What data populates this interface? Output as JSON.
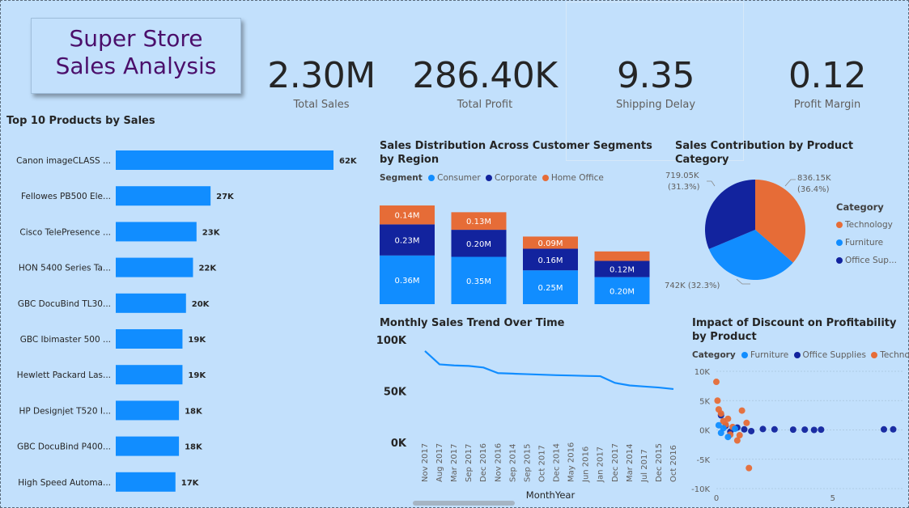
{
  "title": {
    "line1": "Super Store",
    "line2": "Sales Analysis"
  },
  "kpis": [
    {
      "value": "2.30M",
      "label": "Total Sales"
    },
    {
      "value": "286.40K",
      "label": "Total Profit"
    },
    {
      "value": "9.35",
      "label": "Shipping Delay"
    },
    {
      "value": "0.12",
      "label": "Profit Margin"
    }
  ],
  "colors": {
    "consumer": "#118dff",
    "corporate": "#12239e",
    "home_office": "#e66c37",
    "technology": "#e66c37",
    "furniture": "#118dff",
    "office_supplies": "#12239e",
    "background": "#c2e0fc"
  },
  "chart_data": [
    {
      "type": "bar",
      "title": "Top 10 Products by Sales",
      "orientation": "horizontal",
      "categories": [
        "Canon imageCLASS ...",
        "Fellowes PB500 Ele...",
        "Cisco TelePresence ...",
        "HON 5400 Series Ta...",
        "GBC DocuBind TL30...",
        "GBC Ibimaster 500 ...",
        "Hewlett Packard Las...",
        "HP Designjet T520 I...",
        "GBC DocuBind P400...",
        "High Speed Automa..."
      ],
      "values": [
        62,
        27,
        23,
        22,
        20,
        19,
        19,
        18,
        18,
        17
      ],
      "value_labels": [
        "62K",
        "27K",
        "23K",
        "22K",
        "20K",
        "19K",
        "19K",
        "18K",
        "18K",
        "17K"
      ],
      "color": "#118dff"
    },
    {
      "type": "bar",
      "stacked": true,
      "title": "Sales Distribution Across Customer Segments by Region",
      "legend_title": "Segment",
      "categories": [
        "",
        "",
        "",
        ""
      ],
      "series": [
        {
          "name": "Consumer",
          "color": "#118dff",
          "values": [
            0.36,
            0.35,
            0.25,
            0.2
          ],
          "labels": [
            "0.36M",
            "0.35M",
            "0.25M",
            "0.20M"
          ]
        },
        {
          "name": "Corporate",
          "color": "#12239e",
          "values": [
            0.23,
            0.2,
            0.16,
            0.12
          ],
          "labels": [
            "0.23M",
            "0.20M",
            "0.16M",
            "0.12M"
          ]
        },
        {
          "name": "Home Office",
          "color": "#e66c37",
          "values": [
            0.14,
            0.13,
            0.09,
            0.07
          ],
          "labels": [
            "0.14M",
            "0.13M",
            "0.09M",
            ""
          ]
        }
      ],
      "unit": "M"
    },
    {
      "type": "pie",
      "title": "Sales Contribution by Product Category",
      "legend_title": "Category",
      "slices": [
        {
          "name": "Technology",
          "value": 836.15,
          "percent": 36.4,
          "label": "836.15K",
          "pct_label": "(36.4%)",
          "color": "#e66c37"
        },
        {
          "name": "Furniture",
          "value": 742,
          "percent": 32.3,
          "label": "742K (32.3%)",
          "color": "#118dff"
        },
        {
          "name": "Office Sup...",
          "value": 719.05,
          "percent": 31.3,
          "label": "719.05K",
          "pct_label": "(31.3%)",
          "color": "#12239e"
        }
      ]
    },
    {
      "type": "line",
      "title": "Monthly Sales Trend Over Time",
      "xlabel": "MonthYear",
      "ylabel": "",
      "ylim": [
        0,
        100000
      ],
      "yticks": [
        "100K",
        "50K",
        "0K"
      ],
      "x": [
        "Nov 2017",
        "Aug 2017",
        "Mar 2017",
        "Sep 2017",
        "Dec 2016",
        "Nov 2016",
        "Sep 2014",
        "Sep 2015",
        "Oct 2017",
        "Dec 2014",
        "May 2016",
        "Jun 2016",
        "Jan 2017",
        "Dec 2017",
        "Mar 2014",
        "Jul 2017",
        "Dec 2015",
        "Oct 2016"
      ],
      "values": [
        89000,
        76000,
        75000,
        74500,
        73000,
        67500,
        67000,
        66500,
        66000,
        65500,
        65200,
        64800,
        64500,
        58000,
        55500,
        54500,
        53500,
        52000
      ],
      "color": "#118dff"
    },
    {
      "type": "scatter",
      "title": "Impact of Discount on Profitability by Product",
      "legend_title": "Category",
      "xlim": [
        0,
        8
      ],
      "ylim": [
        -10000,
        10000
      ],
      "xticks": [
        "0",
        "5"
      ],
      "yticks": [
        "10K",
        "5K",
        "0K",
        "-5K",
        "-10K"
      ],
      "series": [
        {
          "name": "Furniture",
          "color": "#118dff",
          "points": [
            [
              0.1,
              800
            ],
            [
              0.2,
              -500
            ],
            [
              0.3,
              300
            ],
            [
              0.5,
              -1200
            ],
            [
              0.8,
              200
            ]
          ]
        },
        {
          "name": "Office Supplies",
          "color": "#12239e",
          "points": [
            [
              0.2,
              2500
            ],
            [
              0.4,
              700
            ],
            [
              0.6,
              -300
            ],
            [
              0.9,
              400
            ],
            [
              1.2,
              100
            ],
            [
              1.5,
              -200
            ],
            [
              2.0,
              150
            ],
            [
              2.5,
              100
            ],
            [
              3.3,
              50
            ],
            [
              3.8,
              50
            ],
            [
              4.2,
              0
            ],
            [
              4.5,
              50
            ],
            [
              7.2,
              100
            ],
            [
              7.6,
              100
            ]
          ]
        },
        {
          "name": "Technology",
          "color": "#e66c37",
          "points": [
            [
              0.0,
              8200
            ],
            [
              0.05,
              5000
            ],
            [
              0.1,
              3500
            ],
            [
              0.2,
              2800
            ],
            [
              0.3,
              1500
            ],
            [
              0.4,
              900
            ],
            [
              0.6,
              -800
            ],
            [
              0.9,
              -1800
            ],
            [
              1.1,
              3300
            ],
            [
              1.3,
              1200
            ],
            [
              1.4,
              -6500
            ],
            [
              0.5,
              1900
            ],
            [
              0.7,
              500
            ],
            [
              1.0,
              -900
            ]
          ]
        }
      ]
    }
  ]
}
